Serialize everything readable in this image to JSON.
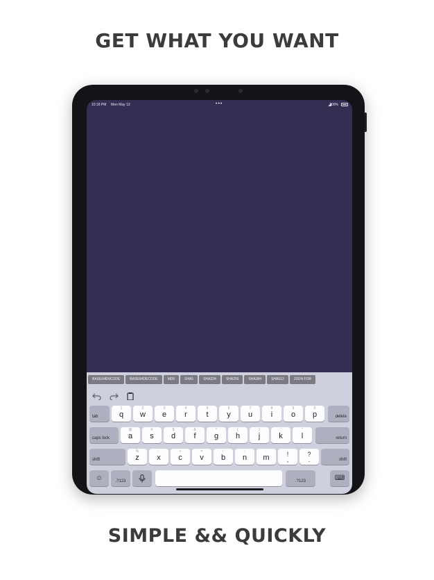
{
  "headlines": {
    "top": "GET WHAT YOU WANT",
    "bottom": "SIMPLE && QUICKLY"
  },
  "status_bar": {
    "time": "10:18 PM",
    "date": "Mon May 13",
    "dots": "•••",
    "battery": "100%"
  },
  "colors": {
    "screen_bg": "#332f52",
    "keyboard_bg": "#cfd0dd",
    "chip_bg": "#7b7a83",
    "headline": "#3b3b3b"
  },
  "chips": [
    "BASE64ENCODE",
    "BASE64DECODE",
    "MD5",
    "SHA1",
    "SHA224",
    "SHA256",
    "SHA384",
    "SHA512",
    "JSON FOR"
  ],
  "shortcuts": {
    "undo": "undo-icon",
    "redo": "redo-icon",
    "paste": "clipboard-icon"
  },
  "keyboard": {
    "row1": {
      "tab": "tab",
      "delete": "delete",
      "keys": [
        {
          "main": "q",
          "sub": "1"
        },
        {
          "main": "w",
          "sub": "2"
        },
        {
          "main": "e",
          "sub": "3"
        },
        {
          "main": "r",
          "sub": "4"
        },
        {
          "main": "t",
          "sub": "5"
        },
        {
          "main": "y",
          "sub": "6"
        },
        {
          "main": "u",
          "sub": "7"
        },
        {
          "main": "i",
          "sub": "8"
        },
        {
          "main": "o",
          "sub": "9"
        },
        {
          "main": "p",
          "sub": "0"
        }
      ]
    },
    "row2": {
      "caps": "caps lock",
      "return": "return",
      "keys": [
        {
          "main": "a",
          "sub": "@"
        },
        {
          "main": "s",
          "sub": "#"
        },
        {
          "main": "d",
          "sub": "$"
        },
        {
          "main": "f",
          "sub": "&"
        },
        {
          "main": "g",
          "sub": "*"
        },
        {
          "main": "h",
          "sub": "("
        },
        {
          "main": "j",
          "sub": ")"
        },
        {
          "main": "k",
          "sub": "'"
        },
        {
          "main": "l",
          "sub": "\""
        }
      ]
    },
    "row3": {
      "shift_left": "shift",
      "shift_right": "shift",
      "keys": [
        {
          "main": "z",
          "sub": "%"
        },
        {
          "main": "x",
          "sub": "-"
        },
        {
          "main": "c",
          "sub": "+"
        },
        {
          "main": "v",
          "sub": "="
        },
        {
          "main": "b",
          "sub": "/"
        },
        {
          "main": "n",
          "sub": ";"
        },
        {
          "main": "m",
          "sub": ":"
        }
      ],
      "punct": [
        {
          "top": "!",
          "bottom": ","
        },
        {
          "top": "?",
          "bottom": "."
        }
      ]
    },
    "row4": {
      "emoji": "emoji-icon",
      "numbers_left": ".?123",
      "mic": "microphone-icon",
      "space": "",
      "numbers_right": ".?123",
      "dismiss": "keyboard-dismiss-icon"
    }
  }
}
